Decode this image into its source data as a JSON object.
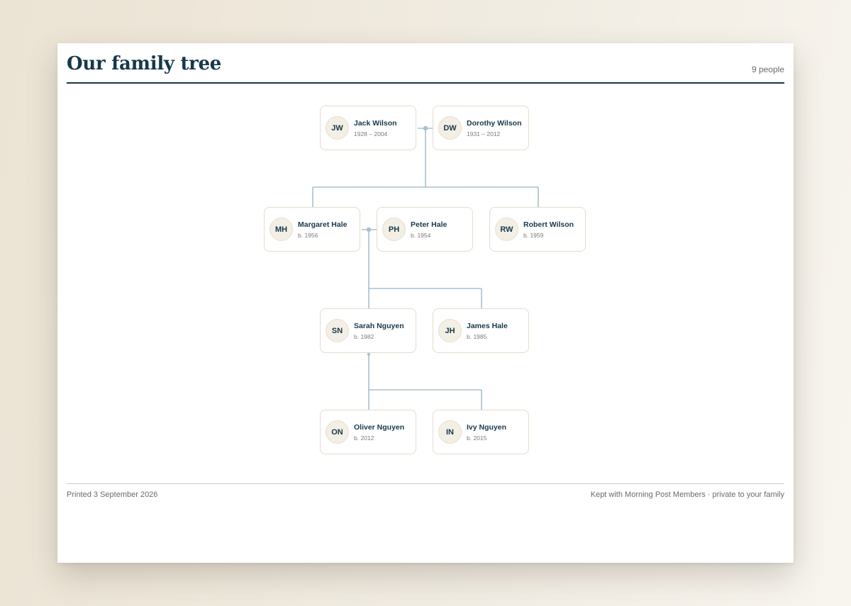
{
  "header": {
    "title": "Our family tree",
    "count": "9 people"
  },
  "footer": {
    "printed": "Printed 3 September 2026",
    "note": "Kept with Morning Post Members · private to your family"
  },
  "colors": {
    "ink": "#16384a",
    "connector": "#a9bfcf",
    "card_border": "#e2dccb",
    "avatar_fill": "#f4efe4"
  },
  "people": [
    {
      "id": "jw",
      "initials": "JW",
      "name": "Jack Wilson",
      "dates": "1928 – 2004"
    },
    {
      "id": "dw",
      "initials": "DW",
      "name": "Dorothy Wilson",
      "dates": "1931 – 2012"
    },
    {
      "id": "mh",
      "initials": "MH",
      "name": "Margaret Hale",
      "dates": "b. 1956"
    },
    {
      "id": "ph",
      "initials": "PH",
      "name": "Peter Hale",
      "dates": "b. 1954"
    },
    {
      "id": "rw",
      "initials": "RW",
      "name": "Robert Wilson",
      "dates": "b. 1959"
    },
    {
      "id": "sn",
      "initials": "SN",
      "name": "Sarah Nguyen",
      "dates": "b. 1982"
    },
    {
      "id": "jh",
      "initials": "JH",
      "name": "James Hale",
      "dates": "b. 1985"
    },
    {
      "id": "on",
      "initials": "ON",
      "name": "Oliver Nguyen",
      "dates": "b. 2012"
    },
    {
      "id": "in",
      "initials": "IN",
      "name": "Ivy Nguyen",
      "dates": "b. 2015"
    }
  ],
  "relationships": {
    "couples": [
      [
        "jw",
        "dw"
      ],
      [
        "mh",
        "ph"
      ]
    ],
    "families": [
      {
        "parents": [
          "jw",
          "dw"
        ],
        "children": [
          "mh",
          "rw"
        ]
      },
      {
        "parents": [
          "mh",
          "ph"
        ],
        "children": [
          "sn",
          "jh"
        ]
      },
      {
        "parents": [
          "sn"
        ],
        "children": [
          "on",
          "in"
        ]
      }
    ]
  }
}
